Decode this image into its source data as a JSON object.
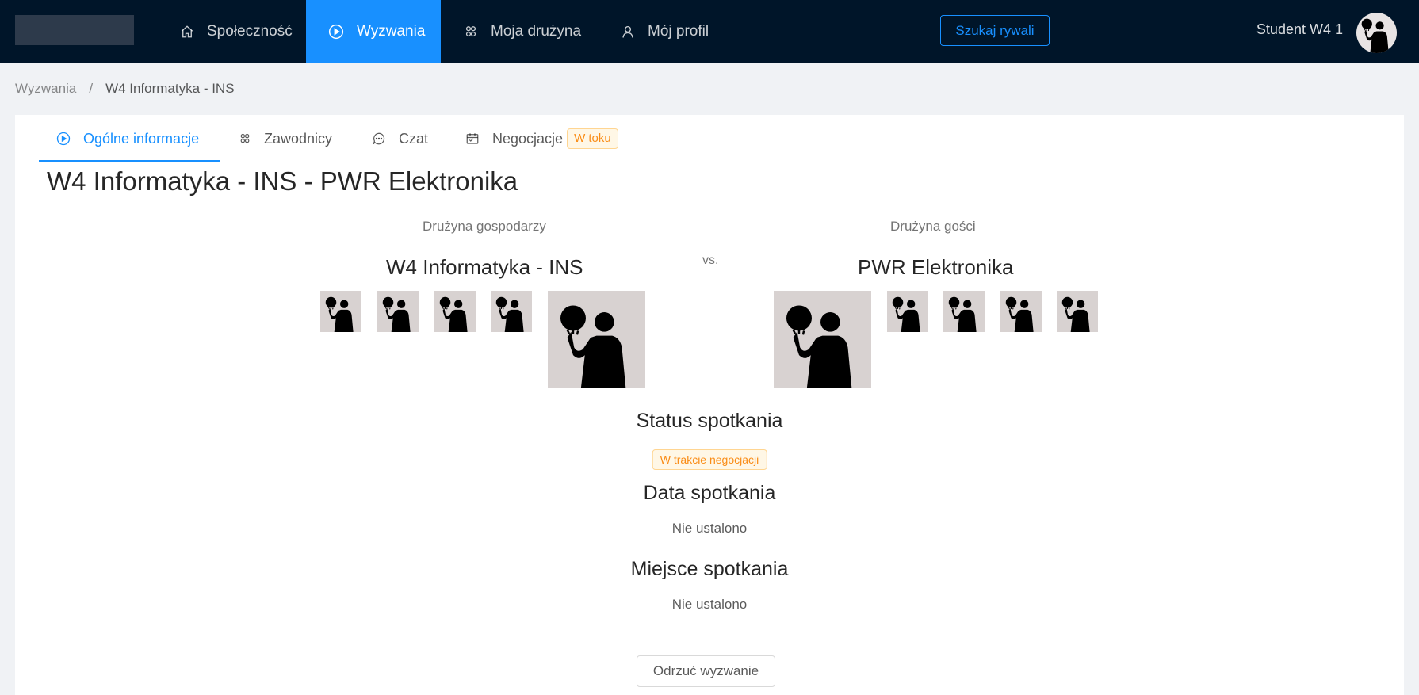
{
  "nav": {
    "items": [
      {
        "label": "Społeczność",
        "icon": "home-icon"
      },
      {
        "label": "Wyzwania",
        "icon": "play-circle-icon"
      },
      {
        "label": "Moja drużyna",
        "icon": "team-icon"
      },
      {
        "label": "Mój profil",
        "icon": "user-icon"
      }
    ],
    "search_label": "Szukaj rywali",
    "user_name": "Student W4 1"
  },
  "breadcrumb": {
    "items": [
      "Wyzwania",
      "W4 Informatyka - INS"
    ],
    "separator": "/"
  },
  "tabs": [
    {
      "label": "Ogólne informacje",
      "icon": "play-circle-icon",
      "active": true
    },
    {
      "label": "Zawodnicy",
      "icon": "team-icon"
    },
    {
      "label": "Czat",
      "icon": "message-icon"
    },
    {
      "label": "Negocjacje",
      "icon": "calendar-icon",
      "tag": "W toku"
    }
  ],
  "match": {
    "title": "W4 Informatyka - INS - PWR Elektronika",
    "home": {
      "caption": "Drużyna gospodarzy",
      "name": "W4 Informatyka - INS"
    },
    "vs": "vs.",
    "away": {
      "caption": "Drużyna gości",
      "name": "PWR Elektronika"
    }
  },
  "details": {
    "status_title": "Status spotkania",
    "status_value": "W trakcie negocjacji",
    "date_title": "Data spotkania",
    "date_value": "Nie ustalono",
    "place_title": "Miejsce spotkania",
    "place_value": "Nie ustalono"
  },
  "actions": {
    "reject_label": "Odrzuć wyzwanie"
  },
  "colors": {
    "header_bg": "#001529",
    "accent": "#1890ff",
    "warning": "#fa8c16",
    "page_bg": "#f0f2f5"
  }
}
